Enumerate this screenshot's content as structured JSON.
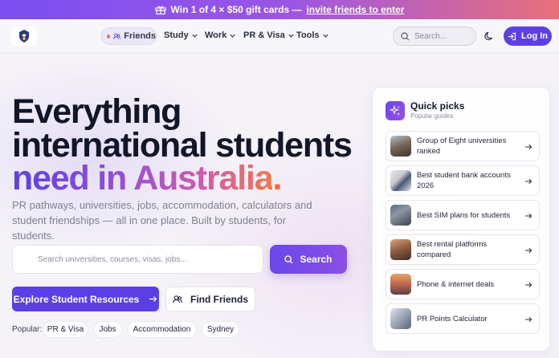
{
  "promo": {
    "text": "Win 1 of 4 × $50 gift cards —",
    "link": "invite friends to enter"
  },
  "nav": {
    "friends": "Friends",
    "items": [
      {
        "label": "Study"
      },
      {
        "label": "Work"
      },
      {
        "label": "PR & Visa"
      },
      {
        "label": "Tools"
      }
    ],
    "search_placeholder": "Search...",
    "login": "Log In"
  },
  "hero": {
    "line1": "Everything",
    "line2": "international students",
    "line3_gradient": "need in Australia",
    "line3_period": ".",
    "subtitle": "PR pathways, universities, jobs, accommodation, calculators and student friendships — all in one place. Built by students, for students.",
    "search_placeholder": "Search universities, courses, visas, jobs...",
    "search_button": "Search",
    "explore_button": "Explore Student Resources",
    "friends_button": "Find Friends",
    "popular_label": "Popular:",
    "popular_chips": [
      "PR & Visa",
      "Jobs",
      "Accommodation",
      "Sydney"
    ]
  },
  "quick_picks": {
    "title": "Quick picks",
    "subtitle": "Popular guides",
    "items": [
      {
        "label": "Group of Eight universities ranked"
      },
      {
        "label": "Best student bank accounts 2026"
      },
      {
        "label": "Best SIM plans for students"
      },
      {
        "label": "Best rental platforms compared"
      },
      {
        "label": "Phone & internet deals"
      },
      {
        "label": "PR Points Calculator"
      }
    ]
  },
  "colors": {
    "brand": "#5b3fe4",
    "gradient_start": "#5a43e0",
    "gradient_end": "#ef7a4a",
    "text_dark": "#121628"
  }
}
